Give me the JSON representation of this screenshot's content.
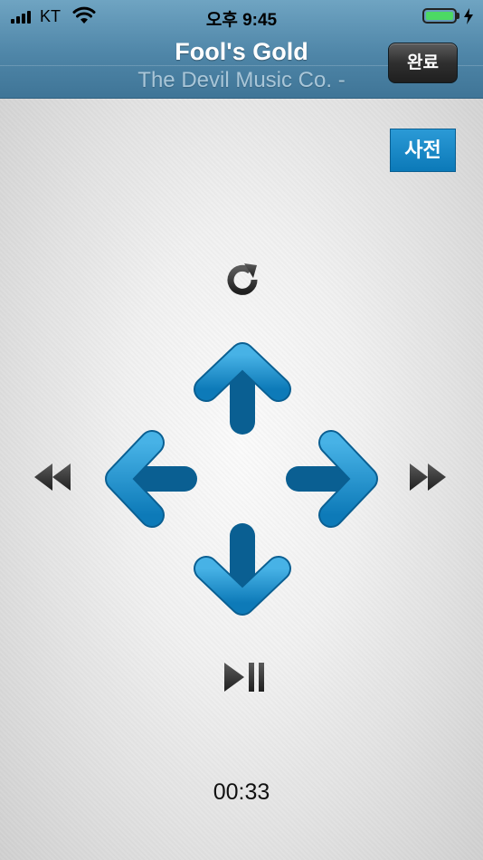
{
  "status_bar": {
    "carrier": "KT",
    "time": "오후 9:45"
  },
  "header": {
    "title": "Fool's Gold",
    "subtitle": "The Devil Music Co. -",
    "done_label": "완료"
  },
  "dictionary_button": {
    "label": "사전"
  },
  "playback": {
    "elapsed": "00:33"
  },
  "colors": {
    "header": "#4f86a8",
    "arrow": "#1f95d3",
    "accent": "#0b79b8"
  },
  "icons": [
    "signal-icon",
    "wifi-icon",
    "battery-icon",
    "charging-icon",
    "refresh-icon",
    "arrow-up-icon",
    "arrow-left-icon",
    "arrow-right-icon",
    "arrow-down-icon",
    "rewind-icon",
    "fast-forward-icon",
    "play-pause-icon"
  ]
}
